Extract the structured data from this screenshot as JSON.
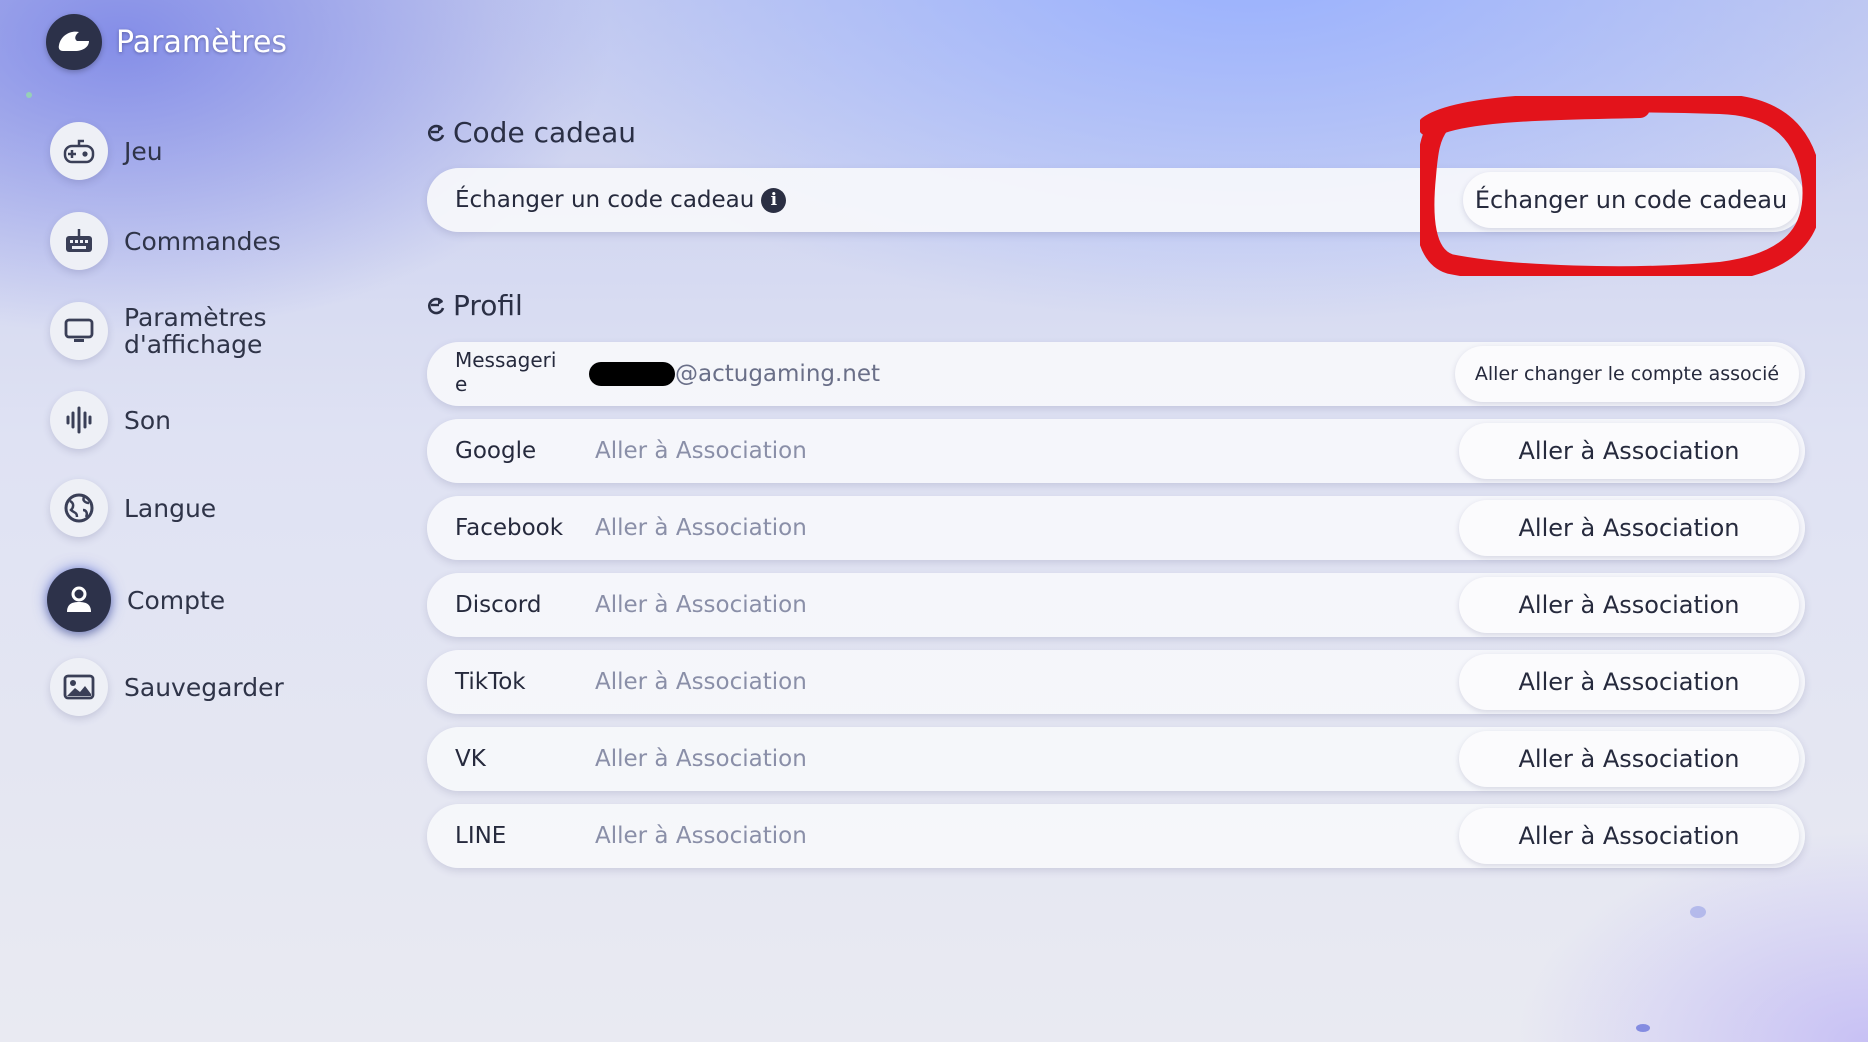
{
  "header": {
    "title": "Paramètres",
    "logo_icon": "game-logo-icon"
  },
  "sidebar": {
    "items": [
      {
        "label": "Jeu",
        "icon": "gamepad-icon",
        "active": false
      },
      {
        "label": "Commandes",
        "icon": "keyboard-icon",
        "active": false
      },
      {
        "label_line1": "Paramètres",
        "label_line2": "d'affichage",
        "icon": "monitor-icon",
        "active": false
      },
      {
        "label": "Son",
        "icon": "sound-wave-icon",
        "active": false
      },
      {
        "label": "Langue",
        "icon": "globe-icon",
        "active": false
      },
      {
        "label": "Compte",
        "icon": "user-icon",
        "active": true
      },
      {
        "label": "Sauvegarder",
        "icon": "image-save-icon",
        "active": false
      }
    ]
  },
  "gift_section": {
    "title": "Code cadeau",
    "row_label": "Échanger un code cadeau",
    "info_icon": "info-icon",
    "action_label": "Échanger un code cadeau",
    "annotation_color": "#e3131b"
  },
  "profile_section": {
    "title": "Profil",
    "email": {
      "label": "Messageri e",
      "label_line1": "Messageri",
      "label_line2": "e",
      "value_suffix": "@actugaming.net",
      "action_label": "Aller changer le compte associé"
    },
    "accounts": [
      {
        "label": "Google",
        "value": "Aller à Association",
        "action_label": "Aller à Association"
      },
      {
        "label": "Facebook",
        "value": "Aller à Association",
        "action_label": "Aller à Association"
      },
      {
        "label": "Discord",
        "value": "Aller à Association",
        "action_label": "Aller à Association"
      },
      {
        "label": "TikTok",
        "value": "Aller à Association",
        "action_label": "Aller à Association"
      },
      {
        "label": "VK",
        "value": "Aller à Association",
        "action_label": "Aller à Association"
      },
      {
        "label": "LINE",
        "value": "Aller à Association",
        "action_label": "Aller à Association"
      }
    ]
  },
  "colors": {
    "accent_dark": "#2d324a",
    "row_bg": "#f6f7fb",
    "muted_text": "#8a8fa8"
  }
}
